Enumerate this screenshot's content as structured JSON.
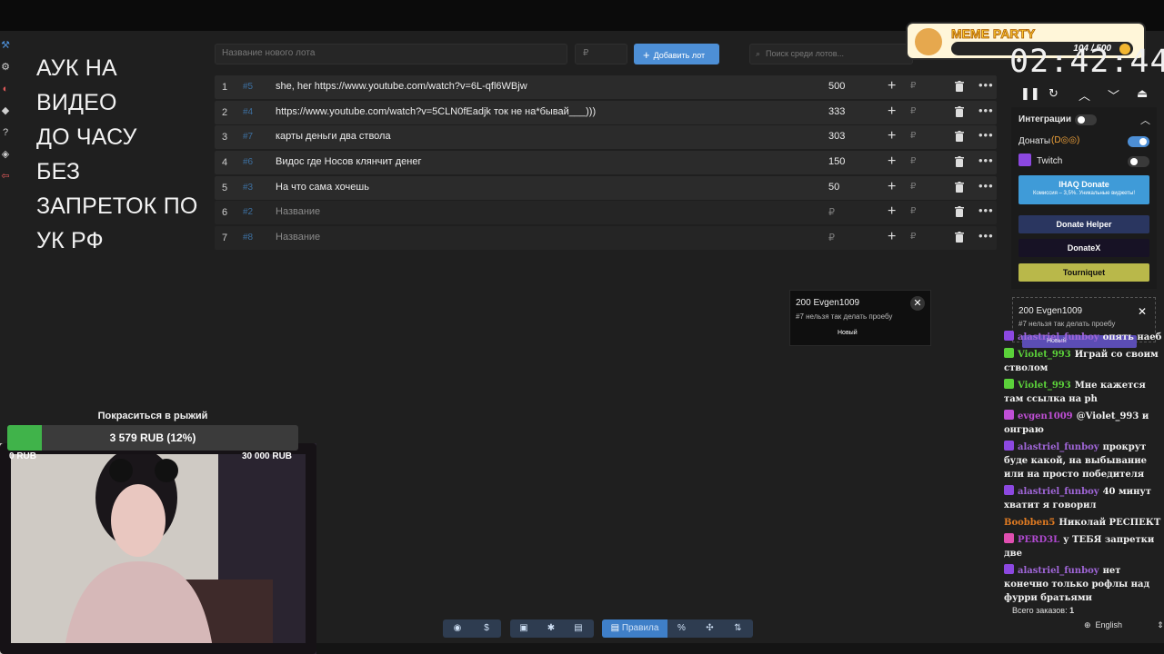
{
  "auk_title_lines": [
    "АУК НА",
    "ВИДЕО",
    "ДО ЧАСУ",
    "БЕЗ",
    "ЗАПРЕТОК ПО",
    "УК РФ"
  ],
  "toolbar": {
    "new_lot_placeholder": "Название нового лота",
    "currency": "₽",
    "add_label": "Добавить лот",
    "search_placeholder": "Поиск среди лотов..."
  },
  "lots": [
    {
      "idx": "1",
      "id": "#5",
      "name": "she, her https://www.youtube.com/watch?v=6L-qfl6WBjw",
      "amount": "500"
    },
    {
      "idx": "2",
      "id": "#4",
      "name": "https://www.youtube.com/watch?v=5CLN0fEadjk ток не на*бывай___)))",
      "amount": "333"
    },
    {
      "idx": "3",
      "id": "#7",
      "name": "карты деньги два ствола",
      "amount": "303"
    },
    {
      "idx": "4",
      "id": "#6",
      "name": "Видос где Носов клянчит денег",
      "amount": "150"
    },
    {
      "idx": "5",
      "id": "#3",
      "name": "На что сама хочешь",
      "amount": "50"
    },
    {
      "idx": "6",
      "id": "#2",
      "name": "Название",
      "amount": "₽"
    },
    {
      "idx": "7",
      "id": "#8",
      "name": "Название",
      "amount": "₽"
    }
  ],
  "row_currency": "₽",
  "popup": {
    "title": "200 Evgen1009",
    "message": "#7 нельзя так делать проебу",
    "button": "Новый"
  },
  "timer": "02:42:44",
  "meme_party": {
    "title": "MEME PARTY",
    "progress": "104 / 500"
  },
  "integrations": {
    "title": "Интеграции",
    "donations_label": "Донаты",
    "twitch_label": "Twitch",
    "ihaq_label": "IHAQ Donate",
    "ihaq_sub": "Комиссия – 3,5%. Уникальные виджеты!",
    "donate_helper": "Donate Helper",
    "donatex": "DonateX",
    "tourniquet": "Tourniquet"
  },
  "chat": [
    {
      "user": "alastriel_funboy",
      "text": "опять наеб",
      "color": "#a066d8"
    },
    {
      "user": "Violet_993",
      "text": "Играй со своим стволом",
      "color": "#5bd13a"
    },
    {
      "user": "Violet_993",
      "text": "Мне кажется там ссылка на ph",
      "color": "#5bd13a"
    },
    {
      "user": "evgen1009",
      "text": "@Violet_993 и онграю",
      "color": "#c04fd6"
    },
    {
      "user": "alastriel_funboy",
      "text": "прокрут буде какой, на выбывание или на просто победителя",
      "color": "#a066d8"
    },
    {
      "user": "alastriel_funboy",
      "text": "40 минут хватит я говорил",
      "color": "#a066d8"
    },
    {
      "user": "Boobben5",
      "text": "Николай РЕСПЕКТ",
      "color": "#e07b22"
    },
    {
      "user": "PERD3L",
      "text": "у ТЕБЯ запретки две",
      "color": "#b04ad0"
    },
    {
      "user": "alastriel_funboy",
      "text": "нет конечно только рофлы над фурри братьями",
      "color": "#a066d8"
    }
  ],
  "orders_label": "Всего заказов:",
  "orders_count": "1",
  "language": "English",
  "goal": {
    "title": "Покраситься в рыжий",
    "text": "3 579 RUB (12%)",
    "min": "0 RUB",
    "max": "30 000 RUB",
    "progress": 0.12
  },
  "bottom_toolbar": {
    "rules_label": "Правила",
    "percent": "%"
  }
}
